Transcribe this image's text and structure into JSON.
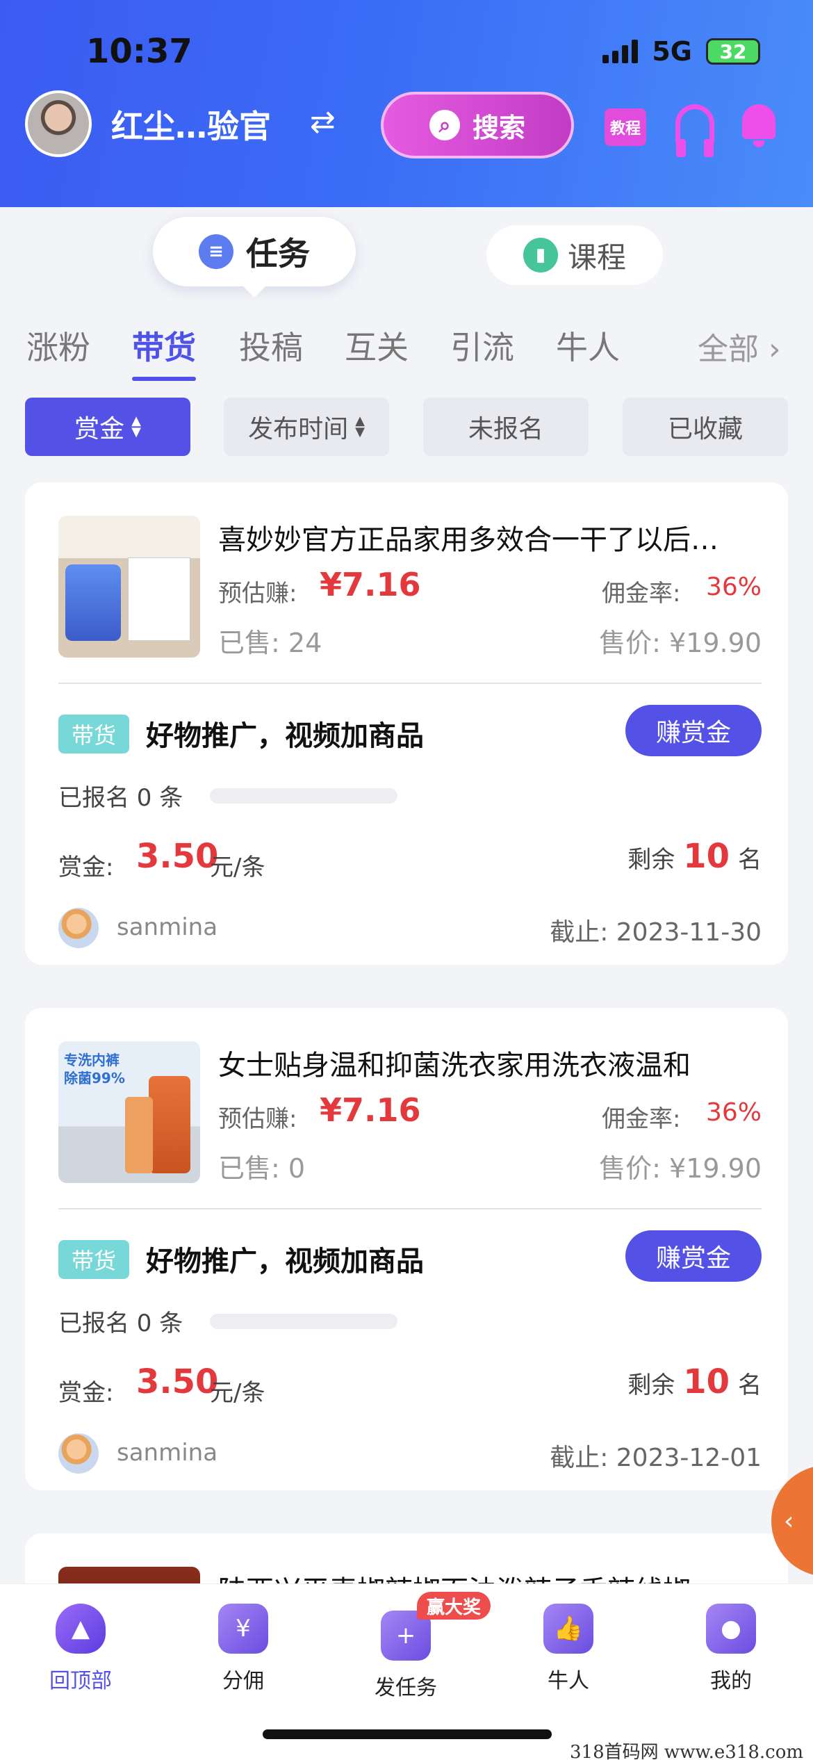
{
  "status_bar": {
    "time": "10:37",
    "network": "5G",
    "battery": "32"
  },
  "header": {
    "user_name": "红尘…验官",
    "search_label": "搜索",
    "tutorial_label": "教程"
  },
  "top_tabs": [
    {
      "label": "任务",
      "active": true
    },
    {
      "label": "课程",
      "active": false
    }
  ],
  "categories": [
    "涨粉",
    "带货",
    "投稿",
    "互关",
    "引流",
    "牛人"
  ],
  "active_category": "带货",
  "category_all": "全部 ›",
  "filters": [
    "赏金",
    "发布时间",
    "未报名",
    "已收藏"
  ],
  "labels": {
    "estimate": "预估赚:",
    "rate": "佣金率:",
    "sold": "已售:",
    "price": "售价:",
    "reward": "赏金:",
    "reward_unit": "元/条",
    "remain_prefix": "剩余",
    "remain_suffix": "名",
    "deadline": "截止:",
    "earn_button": "赚赏金"
  },
  "cards": [
    {
      "title": "喜妙妙官方正品家用多效合一干了以后…",
      "estimate": "¥7.16",
      "rate": "36%",
      "sold": "24",
      "price": "¥19.90",
      "tag": "带货",
      "task_title": "好物推广，视频加商品",
      "signed": "已报名 0 条",
      "progress": 0,
      "reward": "3.50",
      "remaining": "10",
      "publisher": "sanmina",
      "deadline": "2023-11-30"
    },
    {
      "title": "女士贴身温和抑菌洗衣家用洗衣液温和",
      "estimate": "¥7.16",
      "rate": "36%",
      "sold": "0",
      "price": "¥19.90",
      "tag": "带货",
      "task_title": "好物推广，视频加商品",
      "signed": "已报名 0 条",
      "progress": 0,
      "reward": "3.50",
      "remaining": "10",
      "publisher": "sanmina",
      "deadline": "2023-12-01"
    }
  ],
  "card3_title": "陕西兴平麦椒辣椒面油泼辣子香辣线椒",
  "bottom_nav": [
    {
      "label": "回顶部",
      "icon": "rocket-icon",
      "active": true
    },
    {
      "label": "分佣",
      "icon": "yen-icon",
      "active": false
    },
    {
      "label": "发任务",
      "icon": "plus-icon",
      "active": false
    },
    {
      "label": "牛人",
      "icon": "thumb-up-icon",
      "active": false
    },
    {
      "label": "我的",
      "icon": "user-icon",
      "active": false
    }
  ],
  "nav_badge": "赢大奖",
  "watermark": "318首码网  www.e318.com",
  "colors": {
    "accent": "#5452e6",
    "price_red": "#e4393c",
    "header_blue": "#3d5bf1",
    "tag_teal": "#78d8d8"
  }
}
